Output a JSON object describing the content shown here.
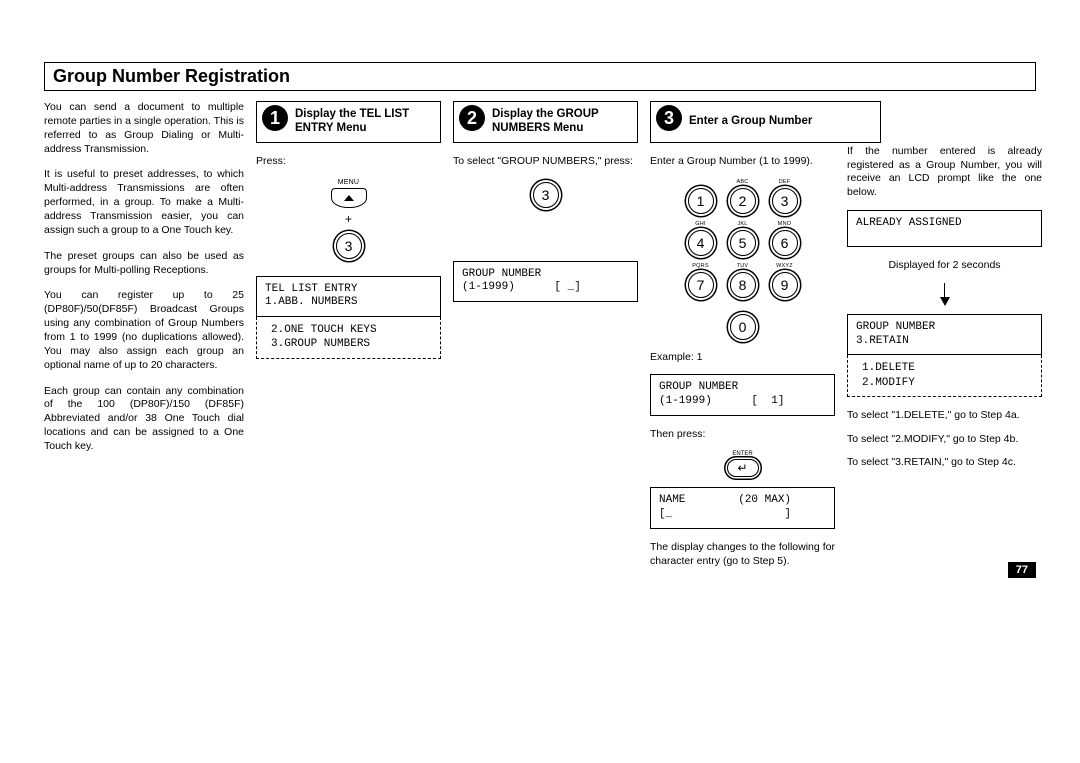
{
  "title": "Group Number Registration",
  "intro": {
    "p1": "You can send a document to multiple remote parties in a single operation. This is referred to as Group Dialing or Multi-address Transmission.",
    "p2": "It is useful to preset addresses, to which Multi-address Transmissions are often performed, in a group. To make a Multi-address Transmission easier, you can assign such a group to a One Touch key.",
    "p3": "The preset groups can also be used as groups for Multi-polling Receptions.",
    "p4": "You can register up to 25 (DP80F)/50(DF85F) Broadcast Groups using any combination of Group Numbers from 1 to 1999 (no duplications allowed). You may also assign each group  an optional  name of up to 20 characters.",
    "p5": "Each group can contain any combination of the 100 (DP80F)/150 (DF85F) Abbreviated and/or 38 One Touch dial locations and can be assigned to a One Touch key."
  },
  "step1": {
    "num": "1",
    "title": "Display the TEL LIST ENTRY Menu",
    "press": "Press:",
    "menu_label": "MENU",
    "key3": "3",
    "lcd_line1": "TEL LIST ENTRY",
    "lcd_line2": "1.ABB. NUMBERS",
    "lcd_extra1": "2.ONE TOUCH KEYS",
    "lcd_extra2": "3.GROUP NUMBERS"
  },
  "step2": {
    "num": "2",
    "title": "Display the GROUP NUMBERS Menu",
    "instr": "To select \"GROUP NUMBERS,\" press:",
    "key3": "3",
    "lcd_line1": "GROUP NUMBER",
    "lcd_line2": "(1-1999)      [ _]"
  },
  "step3": {
    "num": "3",
    "title": "Enter a Group Number",
    "instr": "Enter a Group Number (1 to 1999).",
    "keys": {
      "labels": [
        "",
        "ABC",
        "DEF",
        "GHI",
        "JKL",
        "MNO",
        "PQRS",
        "TUV",
        "WXYZ"
      ],
      "nums": [
        "1",
        "2",
        "3",
        "4",
        "5",
        "6",
        "7",
        "8",
        "9",
        "0"
      ]
    },
    "example_label": "Example: 1",
    "lcd1_line1": "GROUP NUMBER",
    "lcd1_line2": "(1-1999)      [  1]",
    "then": "Then press:",
    "enter_label": "ENTER",
    "enter_glyph": "↵",
    "lcd2_line1": "NAME        (20 MAX)",
    "lcd2_line2": "[_                 ]",
    "after": "The display changes to the following for character entry (go to Step 5)."
  },
  "col4": {
    "p1": "If the number entered is already registered as a Group Number, you will receive an LCD prompt like the one below.",
    "lcd_assigned": "ALREADY ASSIGNED",
    "displayed_for": "Displayed for 2 seconds",
    "lcd_line1": "GROUP NUMBER",
    "lcd_line2": "3.RETAIN",
    "lcd_extra1": "1.DELETE",
    "lcd_extra2": "2.MODIFY",
    "sel1": "To select \"1.DELETE,\" go to Step 4a.",
    "sel2": "To select \"2.MODIFY,\" go to Step 4b.",
    "sel3": "To select \"3.RETAIN,\" go to Step 4c."
  },
  "page_number": "77"
}
